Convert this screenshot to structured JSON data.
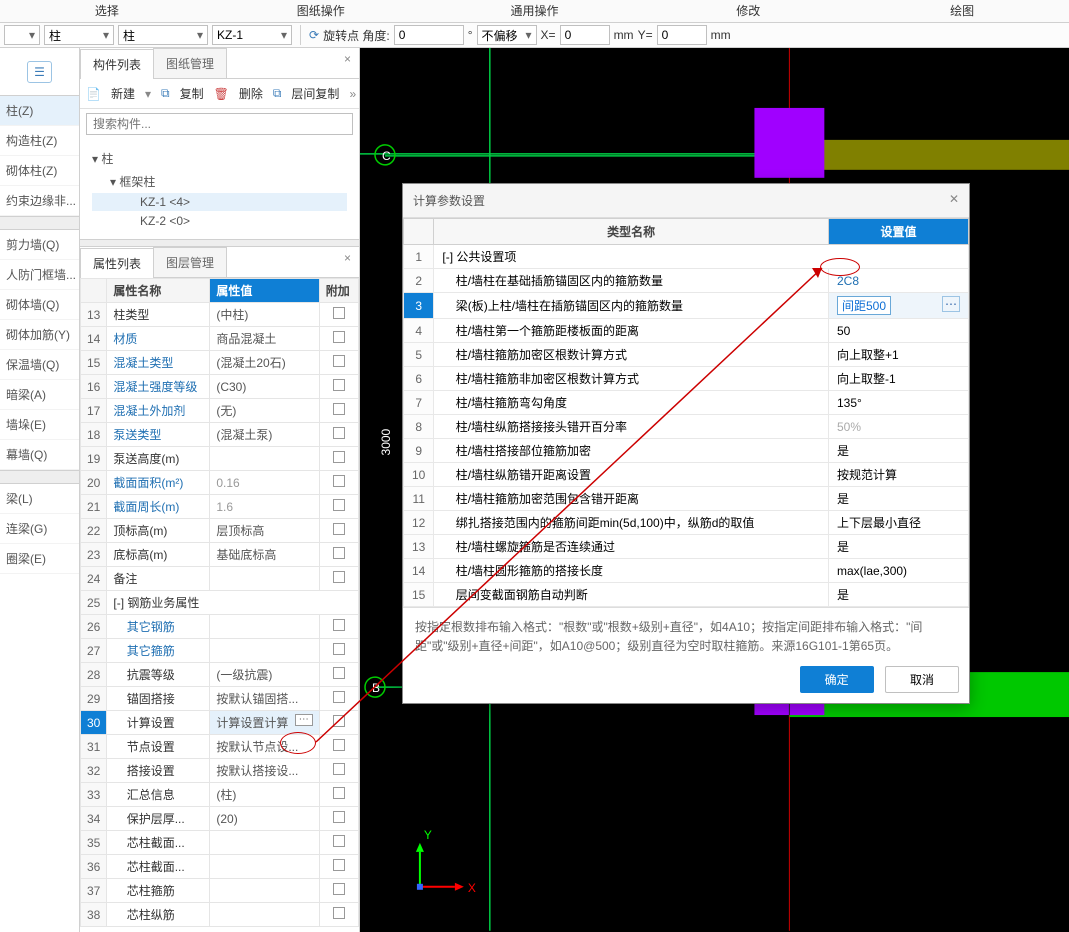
{
  "menu": {
    "select": "选择",
    "drawing": "图纸操作",
    "general": "通用操作",
    "modify": "修改",
    "draw": "绘图"
  },
  "tbar": {
    "dd1": "",
    "dd2": "柱",
    "dd3": "柱",
    "dd4": "KZ-1",
    "rot": "旋转点 角度:",
    "rotval": "0",
    "nooffset": "不偏移",
    "x": "X=",
    "xv": "0",
    "mm": "mm",
    "y": "Y=",
    "yv": "0",
    "mm2": "mm"
  },
  "leftcats": [
    "柱(Z)",
    "构造柱(Z)",
    "砌体柱(Z)",
    "约束边缘非...",
    "",
    "剪力墙(Q)",
    "人防门框墙...",
    "砌体墙(Q)",
    "砌体加筋(Y)",
    "保温墙(Q)",
    "暗梁(A)",
    "墙垛(E)",
    "幕墙(Q)",
    "",
    "梁(L)",
    "连梁(G)",
    "圈梁(E)"
  ],
  "leftcats_sel": 0,
  "tabs": {
    "components": "构件列表",
    "drawings": "图纸管理"
  },
  "toolbar2": {
    "new": "新建",
    "copy": "复制",
    "del": "删除",
    "layercopy": "层间复制"
  },
  "search_placeholder": "搜索构件...",
  "tree": {
    "root": "柱",
    "child": "框架柱",
    "k1": "KZ-1  <4>",
    "k2": "KZ-2  <0>"
  },
  "tabs2": {
    "props": "属性列表",
    "layers": "图层管理"
  },
  "prop_headers": {
    "name": "属性名称",
    "value": "属性值",
    "extra": "附加"
  },
  "props": [
    {
      "n": "13",
      "name": "柱类型",
      "v": "(中柱)",
      "sty": ""
    },
    {
      "n": "14",
      "name": "材质",
      "v": "商品混凝土",
      "sty": "blue"
    },
    {
      "n": "15",
      "name": "混凝土类型",
      "v": "(混凝土20石)",
      "sty": "blue"
    },
    {
      "n": "16",
      "name": "混凝土强度等级",
      "v": "(C30)",
      "sty": "blue"
    },
    {
      "n": "17",
      "name": "混凝土外加剂",
      "v": "(无)",
      "sty": "blue"
    },
    {
      "n": "18",
      "name": "泵送类型",
      "v": "(混凝土泵)",
      "sty": "blue"
    },
    {
      "n": "19",
      "name": "泵送高度(m)",
      "v": "",
      "sty": ""
    },
    {
      "n": "20",
      "name": "截面面积(m²)",
      "v": "0.16",
      "sty": "blue",
      "gray": true
    },
    {
      "n": "21",
      "name": "截面周长(m)",
      "v": "1.6",
      "sty": "blue",
      "gray": true
    },
    {
      "n": "22",
      "name": "顶标高(m)",
      "v": "层顶标高",
      "sty": ""
    },
    {
      "n": "23",
      "name": "底标高(m)",
      "v": "基础底标高",
      "sty": ""
    },
    {
      "n": "24",
      "name": "备注",
      "v": "",
      "sty": ""
    },
    {
      "n": "25",
      "name": "[-] 钢筋业务属性",
      "v": "",
      "sty": "",
      "span": true
    },
    {
      "n": "26",
      "name": "其它钢筋",
      "v": "",
      "sty": "blue",
      "indent": true
    },
    {
      "n": "27",
      "name": "其它箍筋",
      "v": "",
      "sty": "blue",
      "indent": true
    },
    {
      "n": "28",
      "name": "抗震等级",
      "v": "(一级抗震)",
      "sty": "",
      "indent": true
    },
    {
      "n": "29",
      "name": "锚固搭接",
      "v": "按默认锚固搭...",
      "sty": "",
      "indent": true
    },
    {
      "n": "30",
      "name": "计算设置",
      "v": "计算设置计算",
      "sty": "",
      "indent": true,
      "sel": true,
      "dots": true
    },
    {
      "n": "31",
      "name": "节点设置",
      "v": "按默认节点设...",
      "sty": "",
      "indent": true
    },
    {
      "n": "32",
      "name": "搭接设置",
      "v": "按默认搭接设...",
      "sty": "",
      "indent": true
    },
    {
      "n": "33",
      "name": "汇总信息",
      "v": "(柱)",
      "sty": "",
      "indent": true
    },
    {
      "n": "34",
      "name": "保护层厚...",
      "v": "(20)",
      "sty": "",
      "indent": true
    },
    {
      "n": "35",
      "name": "芯柱截面...",
      "v": "",
      "sty": "",
      "indent": true
    },
    {
      "n": "36",
      "name": "芯柱截面...",
      "v": "",
      "sty": "",
      "indent": true
    },
    {
      "n": "37",
      "name": "芯柱箍筋",
      "v": "",
      "sty": "",
      "indent": true
    },
    {
      "n": "38",
      "name": "芯柱纵筋",
      "v": "",
      "sty": "",
      "indent": true
    }
  ],
  "dialog": {
    "title": "计算参数设置",
    "hd1": "类型名称",
    "hd2": "设置值",
    "rows": [
      {
        "n": "1",
        "name": "[-] 公共设置项",
        "v": "",
        "group": true
      },
      {
        "n": "2",
        "name": "柱/墙柱在基础插筋锚固区内的箍筋数量",
        "v": "2C8",
        "blue": true,
        "indent": true,
        "circle": true
      },
      {
        "n": "3",
        "name": "梁(板)上柱/墙柱在插筋锚固区内的箍筋数量",
        "v": "间距500",
        "edit": true,
        "indent": true,
        "hilite": true
      },
      {
        "n": "4",
        "name": "柱/墙柱第一个箍筋距楼板面的距离",
        "v": "50",
        "indent": true
      },
      {
        "n": "5",
        "name": "柱/墙柱箍筋加密区根数计算方式",
        "v": "向上取整+1",
        "indent": true
      },
      {
        "n": "6",
        "name": "柱/墙柱箍筋非加密区根数计算方式",
        "v": "向上取整-1",
        "indent": true
      },
      {
        "n": "7",
        "name": "柱/墙柱箍筋弯勾角度",
        "v": "135°",
        "indent": true
      },
      {
        "n": "8",
        "name": "柱/墙柱纵筋搭接接头错开百分率",
        "v": "50%",
        "gray": true,
        "indent": true
      },
      {
        "n": "9",
        "name": "柱/墙柱搭接部位箍筋加密",
        "v": "是",
        "indent": true
      },
      {
        "n": "10",
        "name": "柱/墙柱纵筋错开距离设置",
        "v": "按规范计算",
        "indent": true
      },
      {
        "n": "11",
        "name": "柱/墙柱箍筋加密范围包含错开距离",
        "v": "是",
        "indent": true
      },
      {
        "n": "12",
        "name": "绑扎搭接范围内的箍筋间距min(5d,100)中，纵筋d的取值",
        "v": "上下层最小直径",
        "indent": true
      },
      {
        "n": "13",
        "name": "柱/墙柱螺旋箍筋是否连续通过",
        "v": "是",
        "indent": true
      },
      {
        "n": "14",
        "name": "柱/墙柱圆形箍筋的搭接长度",
        "v": "max(lae,300)",
        "indent": true
      },
      {
        "n": "15",
        "name": "层间变截面钢筋自动判断",
        "v": "是",
        "indent": true
      }
    ],
    "note": "按指定根数排布输入格式：\"根数\"或\"根数+级别+直径\"，如4A10；按指定间距排布输入格式：\"间距\"或\"级别+直径+间距\"，如A10@500；级别直径为空时取柱箍筋。来源16G101-1第65页。",
    "ok": "确定",
    "cancel": "取消"
  },
  "axes": {
    "x": "X",
    "y": "Y"
  },
  "canvas_labels": {
    "c": "C",
    "b": "B",
    "d3000": "3000"
  }
}
